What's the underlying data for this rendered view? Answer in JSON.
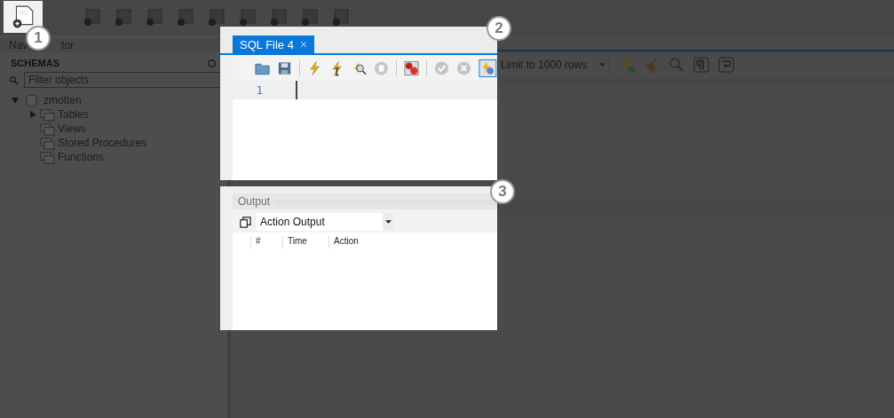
{
  "navigator": {
    "title_parts": [
      "Nav",
      "tor"
    ],
    "section": "SCHEMAS",
    "filter": {
      "placeholder": "Filter objects"
    },
    "tree": [
      {
        "label": "zmotten",
        "expanded": true,
        "children": [
          {
            "label": "Tables",
            "expandable": true
          },
          {
            "label": "Views",
            "expandable": false
          },
          {
            "label": "Stored Procedures",
            "expandable": false
          },
          {
            "label": "Functions",
            "expandable": false
          }
        ]
      }
    ]
  },
  "editor": {
    "tabs": [
      {
        "label": "SQL File 4",
        "selected": true
      }
    ],
    "line_numbers": [
      "1"
    ],
    "limit": "Limit to 1000 rows"
  },
  "output": {
    "title": "Output",
    "mode": "Action Output",
    "columns": [
      "#",
      "Time",
      "Action"
    ]
  },
  "callouts": [
    "1",
    "2",
    "3"
  ]
}
